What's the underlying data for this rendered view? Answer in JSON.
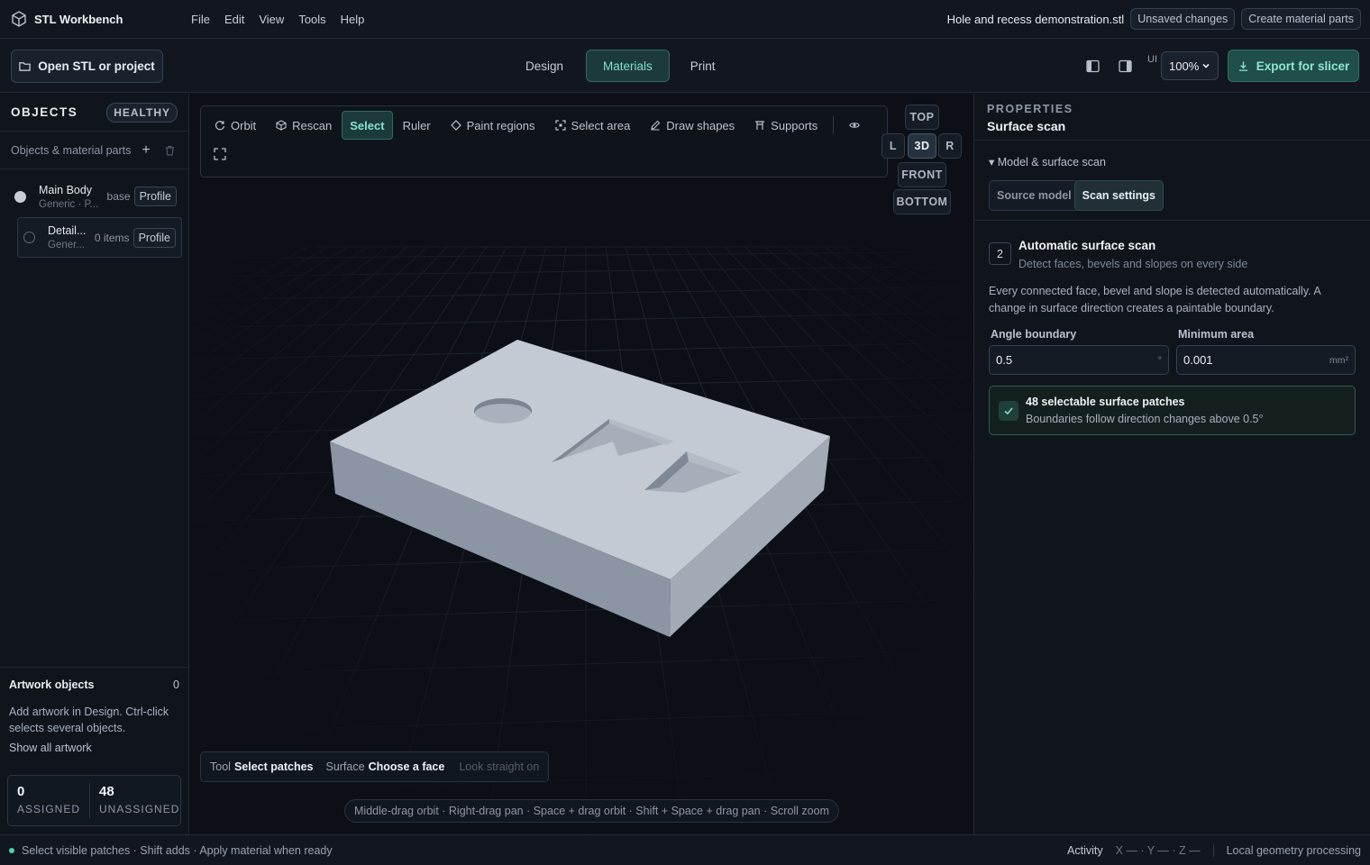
{
  "app": {
    "name": "STL Workbench"
  },
  "menu": [
    "File",
    "Edit",
    "View",
    "Tools",
    "Help"
  ],
  "header": {
    "file_name": "Hole and recess demonstration.stl",
    "unsaved_label": "Unsaved changes",
    "create_parts_label": "Create material parts"
  },
  "toolbar": {
    "open_label": "Open STL or project",
    "modes": [
      "Design",
      "Materials",
      "Print"
    ],
    "active_mode": "Materials",
    "ui_label": "UI",
    "zoom": "100%",
    "export_label": "Export for slicer"
  },
  "left": {
    "title": "OBJECTS",
    "health": "HEALTHY",
    "subtitle": "Objects & material parts",
    "objects": [
      {
        "name": "Main Body",
        "meta": "Generic · P...",
        "tag": "base",
        "button": "Profile",
        "color": "#c8ced6"
      },
      {
        "name": "Detail...",
        "meta": "Gener...",
        "tag": "0 items",
        "button": "Profile",
        "color": "transparent"
      }
    ],
    "artwork": {
      "title": "Artwork objects",
      "count": "0",
      "description": "Add artwork in Design. Ctrl-click selects several objects.",
      "link": "Show all artwork"
    },
    "stats": {
      "assigned_value": "0",
      "assigned_label": "ASSIGNED",
      "unassigned_value": "48",
      "unassigned_label": "UNASSIGNED"
    }
  },
  "viewport": {
    "tools": [
      "Orbit",
      "Rescan",
      "Select",
      "Ruler",
      "Paint regions",
      "Select area",
      "Draw shapes",
      "Supports"
    ],
    "active_tool": "Select",
    "views": {
      "top": "TOP",
      "left": "L",
      "iso": "3D",
      "right": "R",
      "front": "FRONT",
      "bottom": "BOTTOM"
    },
    "status": {
      "tool_label": "Tool",
      "tool_value": "Select patches",
      "surface_label": "Surface",
      "surface_value": "Choose a face",
      "extra": "Look straight on"
    },
    "hint": "Middle-drag orbit · Right-drag pan · Space + drag orbit · Shift + Space + drag pan · Scroll zoom"
  },
  "properties": {
    "kicker": "PROPERTIES",
    "title": "Surface scan",
    "section": "Model & surface scan",
    "tabs": [
      "Source model",
      "Scan settings"
    ],
    "active_tab": "Scan settings",
    "step_number": "2",
    "step_title": "Automatic surface scan",
    "step_description": "Detect faces, bevels and slopes on every side",
    "paragraph": "Every connected face, bevel and slope is detected automatically. A change in surface direction creates a paintable boundary.",
    "angle_label": "Angle boundary",
    "angle_value": "0.5",
    "angle_unit": "°",
    "area_label": "Minimum area",
    "area_value": "0.001",
    "area_unit": "mm²",
    "result_title": "48 selectable surface patches",
    "result_subtitle": "Boundaries follow direction changes above 0.5°"
  },
  "statusbar": {
    "message": "Select visible patches · Shift adds · Apply material when ready",
    "activity": "Activity",
    "coords": "X — · Y — · Z —",
    "processing": "Local geometry processing"
  }
}
